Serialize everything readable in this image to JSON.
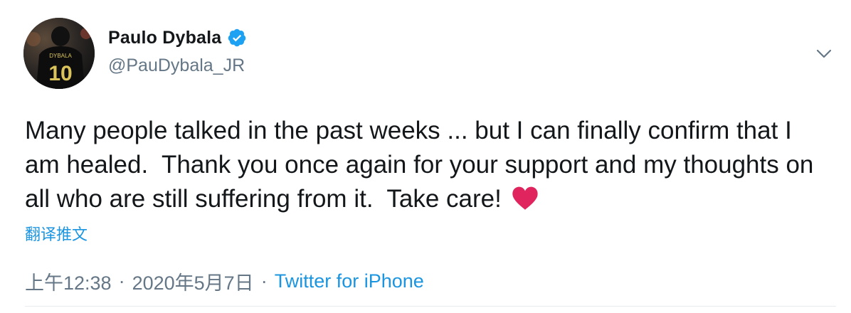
{
  "author": {
    "display_name": "Paulo Dybala",
    "handle": "@PauDybala_JR",
    "verified": true,
    "avatar_jersey_text": "DYBALA",
    "avatar_jersey_number": "10"
  },
  "tweet": {
    "text": "Many people talked in the past weeks ... but I can finally confirm that I am healed.  Thank you once again for your support and my thoughts on all who are still suffering from it.  Take care! ",
    "emoji": "heart-icon",
    "translate_label": "翻译推文"
  },
  "meta": {
    "time": "上午12:38",
    "separator": "·",
    "date": "2020年5月7日",
    "source": "Twitter for iPhone"
  },
  "colors": {
    "link": "#1b95e0",
    "secondary": "#657786",
    "heart": "#e0245e",
    "verified": "#1da1f2"
  }
}
